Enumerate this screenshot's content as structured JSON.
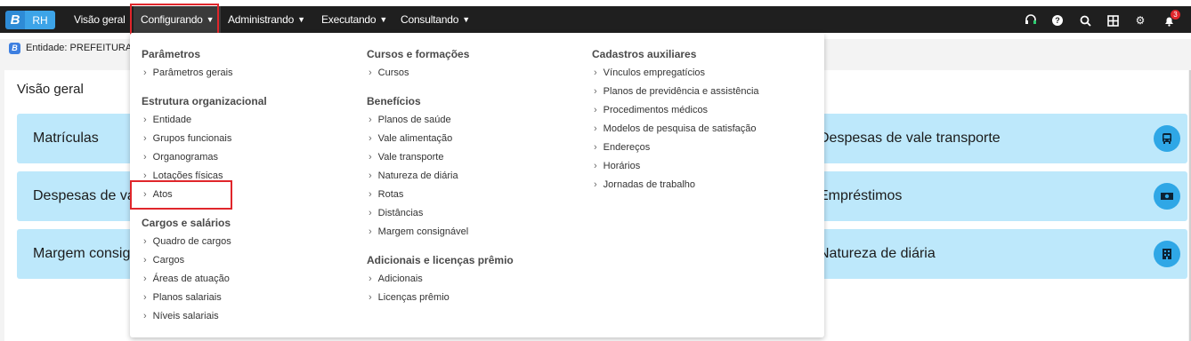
{
  "app": {
    "logo_letter": "B",
    "logo_text": "RH"
  },
  "nav": {
    "items": [
      {
        "label": "Visão geral",
        "has_chevron": false
      },
      {
        "label": "Configurando",
        "has_chevron": true
      },
      {
        "label": "Administrando",
        "has_chevron": true
      },
      {
        "label": "Executando",
        "has_chevron": true
      },
      {
        "label": "Consultando",
        "has_chevron": true
      }
    ],
    "right_icons": [
      "headset-icon",
      "help-icon",
      "search-icon",
      "apps-grid-icon",
      "settings-icon",
      "bell-icon"
    ],
    "notification_count": "3"
  },
  "entity": {
    "icon_letter": "B",
    "label": "Entidade: PREFEITURA D"
  },
  "page_title": "Visão geral",
  "tiles_left": [
    "Matrículas",
    "Despesas de va",
    "Margem consig"
  ],
  "tiles_right": [
    {
      "label": "Despesas de vale transporte",
      "icon": "bus-icon"
    },
    {
      "label": "Empréstimos",
      "icon": "money-icon"
    },
    {
      "label": "Natureza de diária",
      "icon": "building-icon"
    }
  ],
  "dropdown": {
    "col1": {
      "sections": [
        {
          "title": "Parâmetros",
          "items": [
            "Parâmetros gerais"
          ]
        },
        {
          "title": "Estrutura organizacional",
          "items": [
            "Entidade",
            "Grupos funcionais",
            "Organogramas",
            "Lotações físicas",
            "Atos"
          ]
        },
        {
          "title": "Cargos e salários",
          "items": [
            "Quadro de cargos",
            "Cargos",
            "Áreas de atuação",
            "Planos salariais",
            "Níveis salariais"
          ]
        }
      ]
    },
    "col2": {
      "sections": [
        {
          "title": "Cursos e formações",
          "items": [
            "Cursos"
          ]
        },
        {
          "title": "Benefícios",
          "items": [
            "Planos de saúde",
            "Vale alimentação",
            "Vale transporte",
            "Natureza de diária",
            "Rotas",
            "Distâncias",
            "Margem consignável"
          ]
        },
        {
          "title": "Adicionais e licenças prêmio",
          "items": [
            "Adicionais",
            "Licenças prêmio"
          ]
        }
      ]
    },
    "col3": {
      "sections": [
        {
          "title": "Cadastros auxiliares",
          "items": [
            "Vínculos empregatícios",
            "Planos de previdência e assistência",
            "Procedimentos médicos",
            "Modelos de pesquisa de satisfação",
            "Endereços",
            "Horários",
            "Jornadas de trabalho"
          ]
        }
      ]
    }
  },
  "colors": {
    "navbar": "#1f1f1f",
    "tile": "#bde8fb",
    "tile_icon": "#2fa7e6",
    "highlight": "#e0262b"
  }
}
